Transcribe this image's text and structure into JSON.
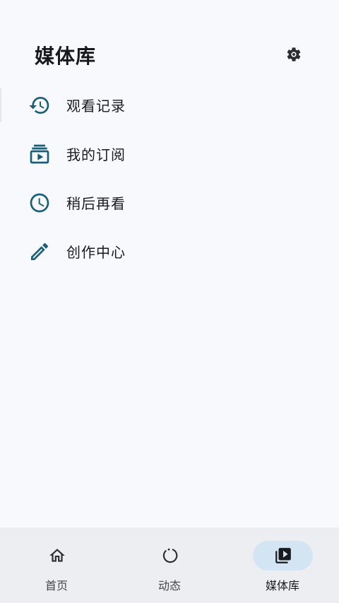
{
  "header": {
    "title": "媒体库",
    "settings_icon": "gear-icon"
  },
  "menu": {
    "items": [
      {
        "label": "观看记录",
        "icon": "history-icon"
      },
      {
        "label": "我的订阅",
        "icon": "subscriptions-icon"
      },
      {
        "label": "稍后再看",
        "icon": "clock-icon"
      },
      {
        "label": "创作中心",
        "icon": "pencil-icon"
      }
    ]
  },
  "navbar": {
    "items": [
      {
        "label": "首页",
        "icon": "home-icon",
        "active": false
      },
      {
        "label": "动态",
        "icon": "refresh-circle-icon",
        "active": false
      },
      {
        "label": "媒体库",
        "icon": "video-library-icon",
        "active": true
      }
    ]
  },
  "colors": {
    "accent_icon": "#185f7a",
    "background": "#f8f9fd",
    "navbar_bg": "#eceef2",
    "active_pill": "#d3e4f3"
  }
}
